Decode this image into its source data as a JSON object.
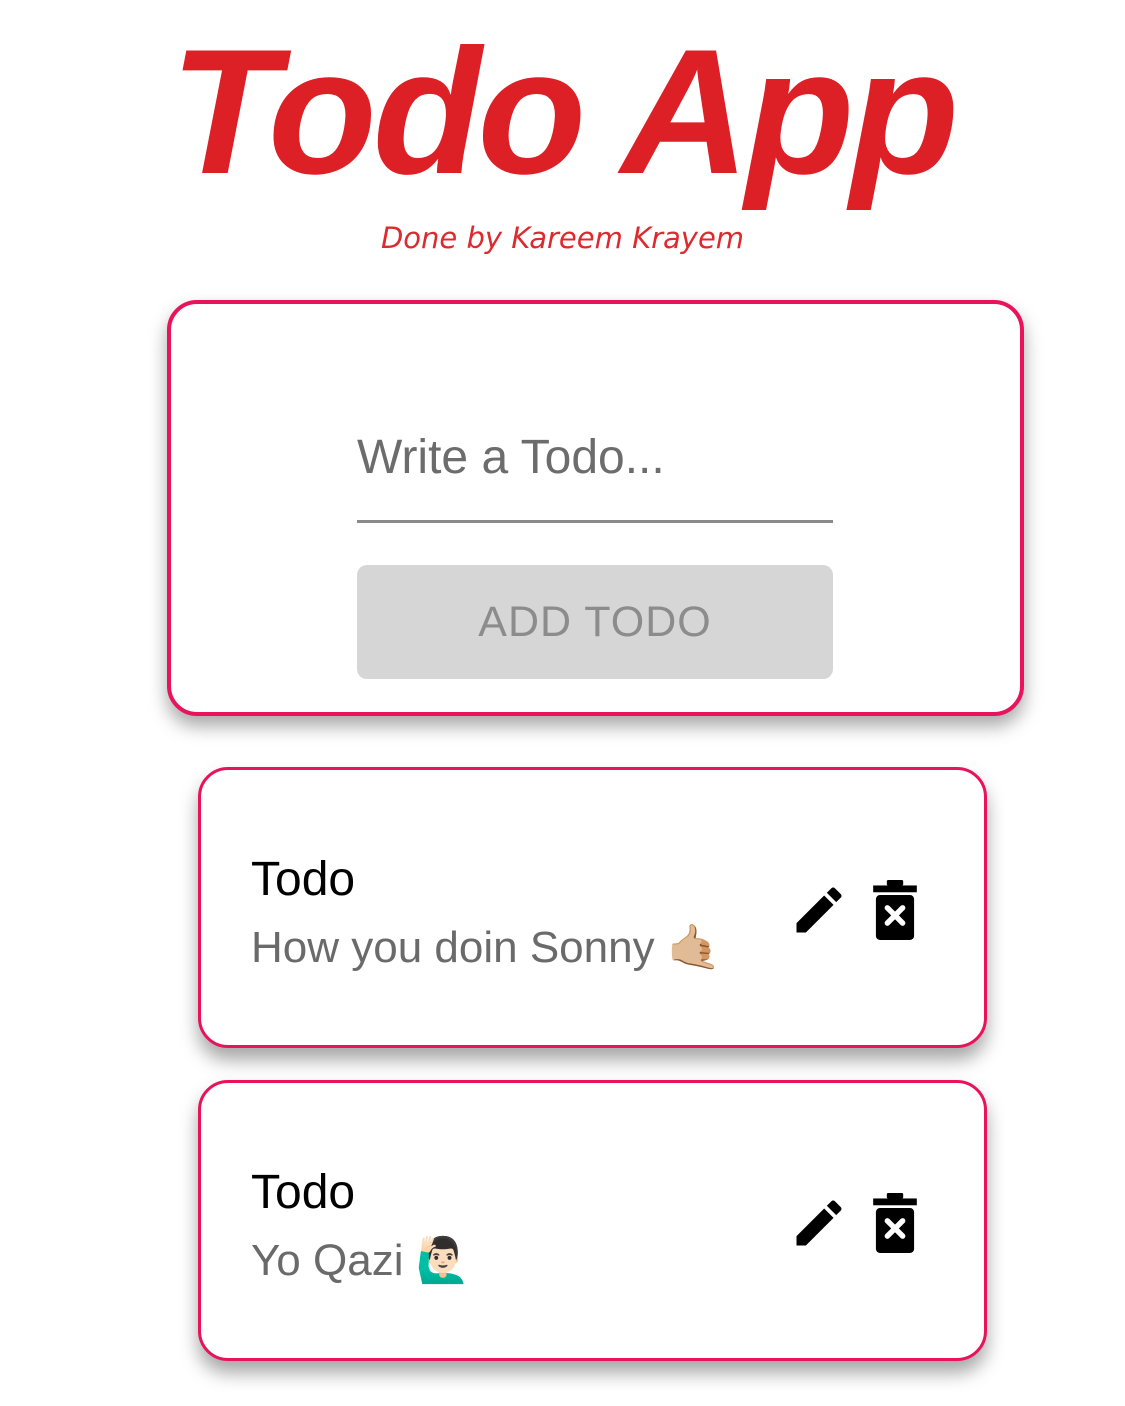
{
  "header": {
    "title": "Todo App",
    "subtitle": "Done by Kareem Krayem"
  },
  "form": {
    "input_placeholder": "Write a Todo...",
    "input_value": "",
    "add_button_label": "ADD TODO"
  },
  "todos": [
    {
      "label": "Todo",
      "text": "How you doin Sonny 🤙🏼"
    },
    {
      "label": "Todo",
      "text": "Yo Qazi 🙋🏻‍♂️"
    }
  ],
  "colors": {
    "title": "#dd1f26",
    "card_border": "#e8135b",
    "button_bg": "#d6d6d6",
    "button_text": "#8c8c8c"
  },
  "icons": {
    "edit": "pencil-icon",
    "delete": "trash-x-icon"
  }
}
